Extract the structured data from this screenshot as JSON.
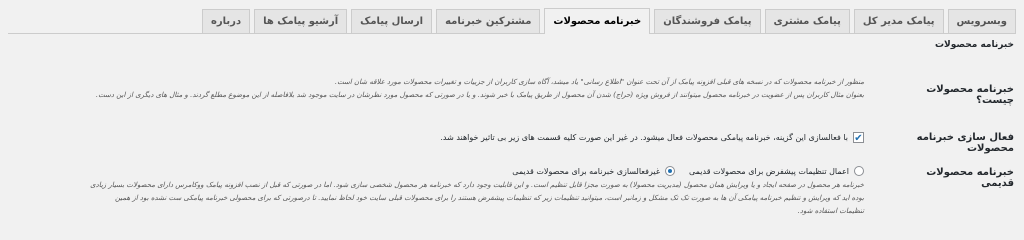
{
  "tabs": [
    {
      "label": "وبسرویس",
      "active": false
    },
    {
      "label": "پیامک مدیر کل",
      "active": false
    },
    {
      "label": "پیامک مشتری",
      "active": false
    },
    {
      "label": "پیامک فروشندگان",
      "active": false
    },
    {
      "label": "خبرنامه محصولات",
      "active": true
    },
    {
      "label": "مشترکین خبرنامه",
      "active": false
    },
    {
      "label": "ارسال پیامک",
      "active": false
    },
    {
      "label": "آرشیو پیامک ها",
      "active": false
    },
    {
      "label": "درباره",
      "active": false
    }
  ],
  "section_title": "خبرنامه محصولات",
  "what_is": {
    "label": "خبرنامه محصولات چیست؟",
    "desc_line1": "منظور از خبرنامه محصولات که در نسخه های قبلی افزونه پیامک از آن تحت عنوان \"اطلاع رسانی\" یاد میشد، آگاه سازی کاربران از جزییات و تغییرات محصولات مورد علاقه شان است.",
    "desc_line2": "بعنوان مثال کاربران پس از عضویت در خبرنامه محصول میتوانند از فروش ویژه (حراج) شدن آن محصول از طریق پیامک با خبر شوند. و یا در صورتی که محصول مورد نظرشان در سایت موجود شد بلافاصله از این موضوع مطلع گردند. و مثال های دیگری از این دست."
  },
  "enable": {
    "label": "فعال سازی خبرنامه محصولات",
    "checked": true,
    "text": "با فعالسازی این گزینه، خبرنامه پیامکی محصولات فعال میشود. در غیر این صورت کلیه قسمت های زیر بی تاثیر خواهند شد."
  },
  "old_products": {
    "label": "خبرنامه محصولات قدیمی",
    "option1": "اعمال تنظیمات پیشفرض برای محصولات قدیمی",
    "option2": "غیرفعالسازی خبرنامه برای محصولات قدیمی",
    "selected": 2,
    "desc_line1": "خبرنامه هر محصول در صفحه ایجاد و یا ویرایش همان محصول (مدیریت محصولا) به صورت مجزا قابل تنظیم است. و این قابلیت وجود دارد که خبرنامه هر محصول شخصی سازی شود. اما در صورتی که قبل از نصب افزونه پیامک ووکامرس دارای محصولات بسیار زیادی",
    "desc_line2": "بوده اید که ویرایش و تنظیم خبرنامه پیامکی آن ها به صورت تک تک مشکل و زمانبر است، میتوانید تنظیمات زیر که تنظیمات پیشفرض هستند را برای محصولات قبلی سایت خود لحاظ نمایید. تا درصورتی که برای محصولی خبرنامه پیامکی ست نشده بود از همین",
    "desc_line3": "تنظیمات استفاده شود."
  }
}
